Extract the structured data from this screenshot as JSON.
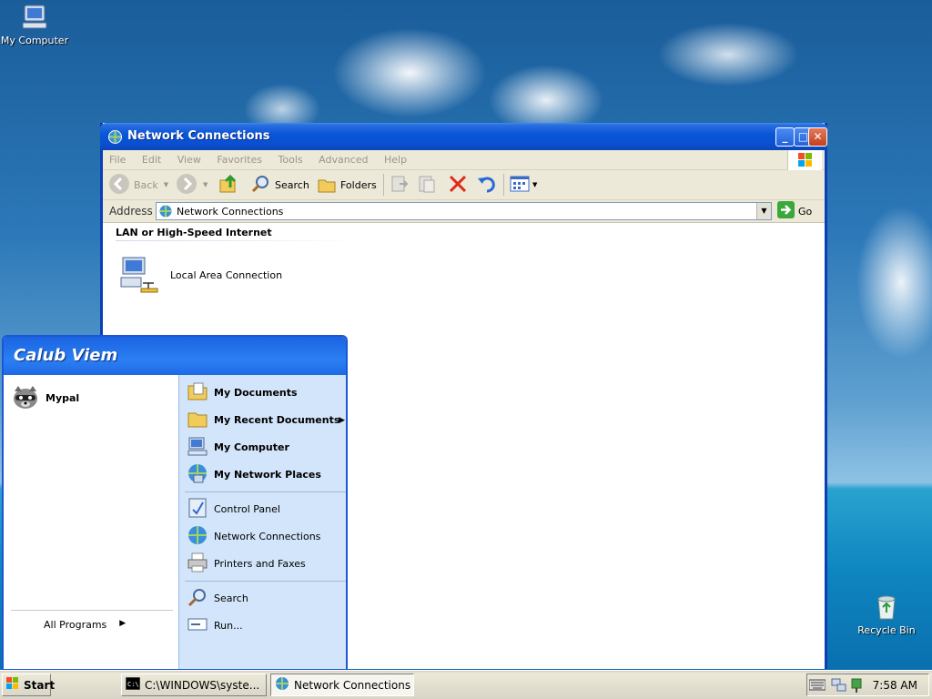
{
  "desktop": {
    "icons": [
      {
        "label": "My Computer",
        "icon": "my-computer-icon"
      },
      {
        "label": "Recycle Bin",
        "icon": "recycle-bin-icon"
      }
    ]
  },
  "window": {
    "title": "Network Connections",
    "menu": [
      "File",
      "Edit",
      "View",
      "Favorites",
      "Tools",
      "Advanced",
      "Help"
    ],
    "toolbar": {
      "back_label": "Back",
      "search_label": "Search",
      "folders_label": "Folders"
    },
    "address": {
      "label": "Address",
      "value": "Network Connections",
      "go_label": "Go"
    },
    "content": {
      "group_header": "LAN or High-Speed Internet",
      "items": [
        {
          "label": "Local Area Connection",
          "icon": "lan-connection-icon"
        }
      ]
    }
  },
  "start_menu": {
    "user_name": "Calub Viem",
    "pinned": [
      {
        "label": "Mypal",
        "icon": "raccoon-icon"
      }
    ],
    "all_programs_label": "All Programs",
    "right_items": [
      {
        "label": "My Documents",
        "bold": true,
        "icon": "my-documents-icon"
      },
      {
        "label": "My Recent Documents",
        "bold": true,
        "icon": "folder-icon",
        "submenu": true
      },
      {
        "label": "My Computer",
        "bold": true,
        "icon": "my-computer-icon"
      },
      {
        "label": "My Network Places",
        "bold": true,
        "icon": "network-places-icon"
      },
      {
        "label": "Control Panel",
        "bold": false,
        "icon": "control-panel-icon"
      },
      {
        "label": "Network Connections",
        "bold": false,
        "icon": "network-connections-icon"
      },
      {
        "label": "Printers and Faxes",
        "bold": false,
        "icon": "printer-icon"
      },
      {
        "label": "Search",
        "bold": false,
        "icon": "search-icon"
      },
      {
        "label": "Run...",
        "bold": false,
        "icon": "run-icon"
      }
    ]
  },
  "taskbar": {
    "start_label": "Start",
    "tasks": [
      {
        "label": "C:\\WINDOWS\\syste...",
        "icon": "console-icon",
        "active": false
      },
      {
        "label": "Network Connections",
        "icon": "network-connections-icon",
        "active": true
      }
    ],
    "clock": "7:58 AM"
  }
}
